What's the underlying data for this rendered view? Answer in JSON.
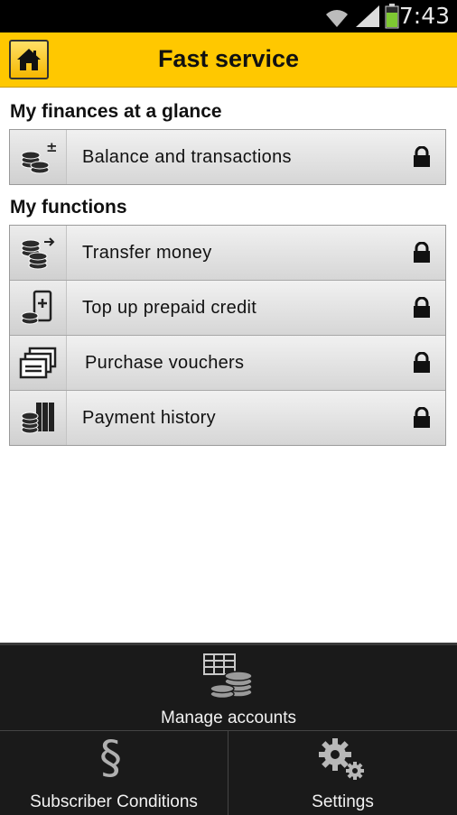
{
  "status_bar": {
    "time": "7:43"
  },
  "header": {
    "title": "Fast service",
    "home_icon": "home-icon"
  },
  "section_finances": {
    "heading": "My finances at a glance",
    "items": [
      {
        "label": "Balance and transactions",
        "icon": "coins-plus-minus-icon",
        "locked": true
      }
    ]
  },
  "section_functions": {
    "heading": "My functions",
    "items": [
      {
        "label": "Transfer money",
        "icon": "coins-transfer-icon",
        "locked": true
      },
      {
        "label": "Top up prepaid credit",
        "icon": "phone-topup-icon",
        "locked": true
      },
      {
        "label": "Purchase vouchers",
        "icon": "vouchers-icon",
        "locked": true
      },
      {
        "label": "Payment history",
        "icon": "payment-history-icon",
        "locked": true
      }
    ]
  },
  "bottom_bar": {
    "manage_label": "Manage accounts",
    "subscriber_label": "Subscriber Conditions",
    "subscriber_symbol": "§",
    "settings_label": "Settings"
  },
  "colors": {
    "accent": "#ffc800",
    "bottom_bar": "#1a1a1a"
  }
}
